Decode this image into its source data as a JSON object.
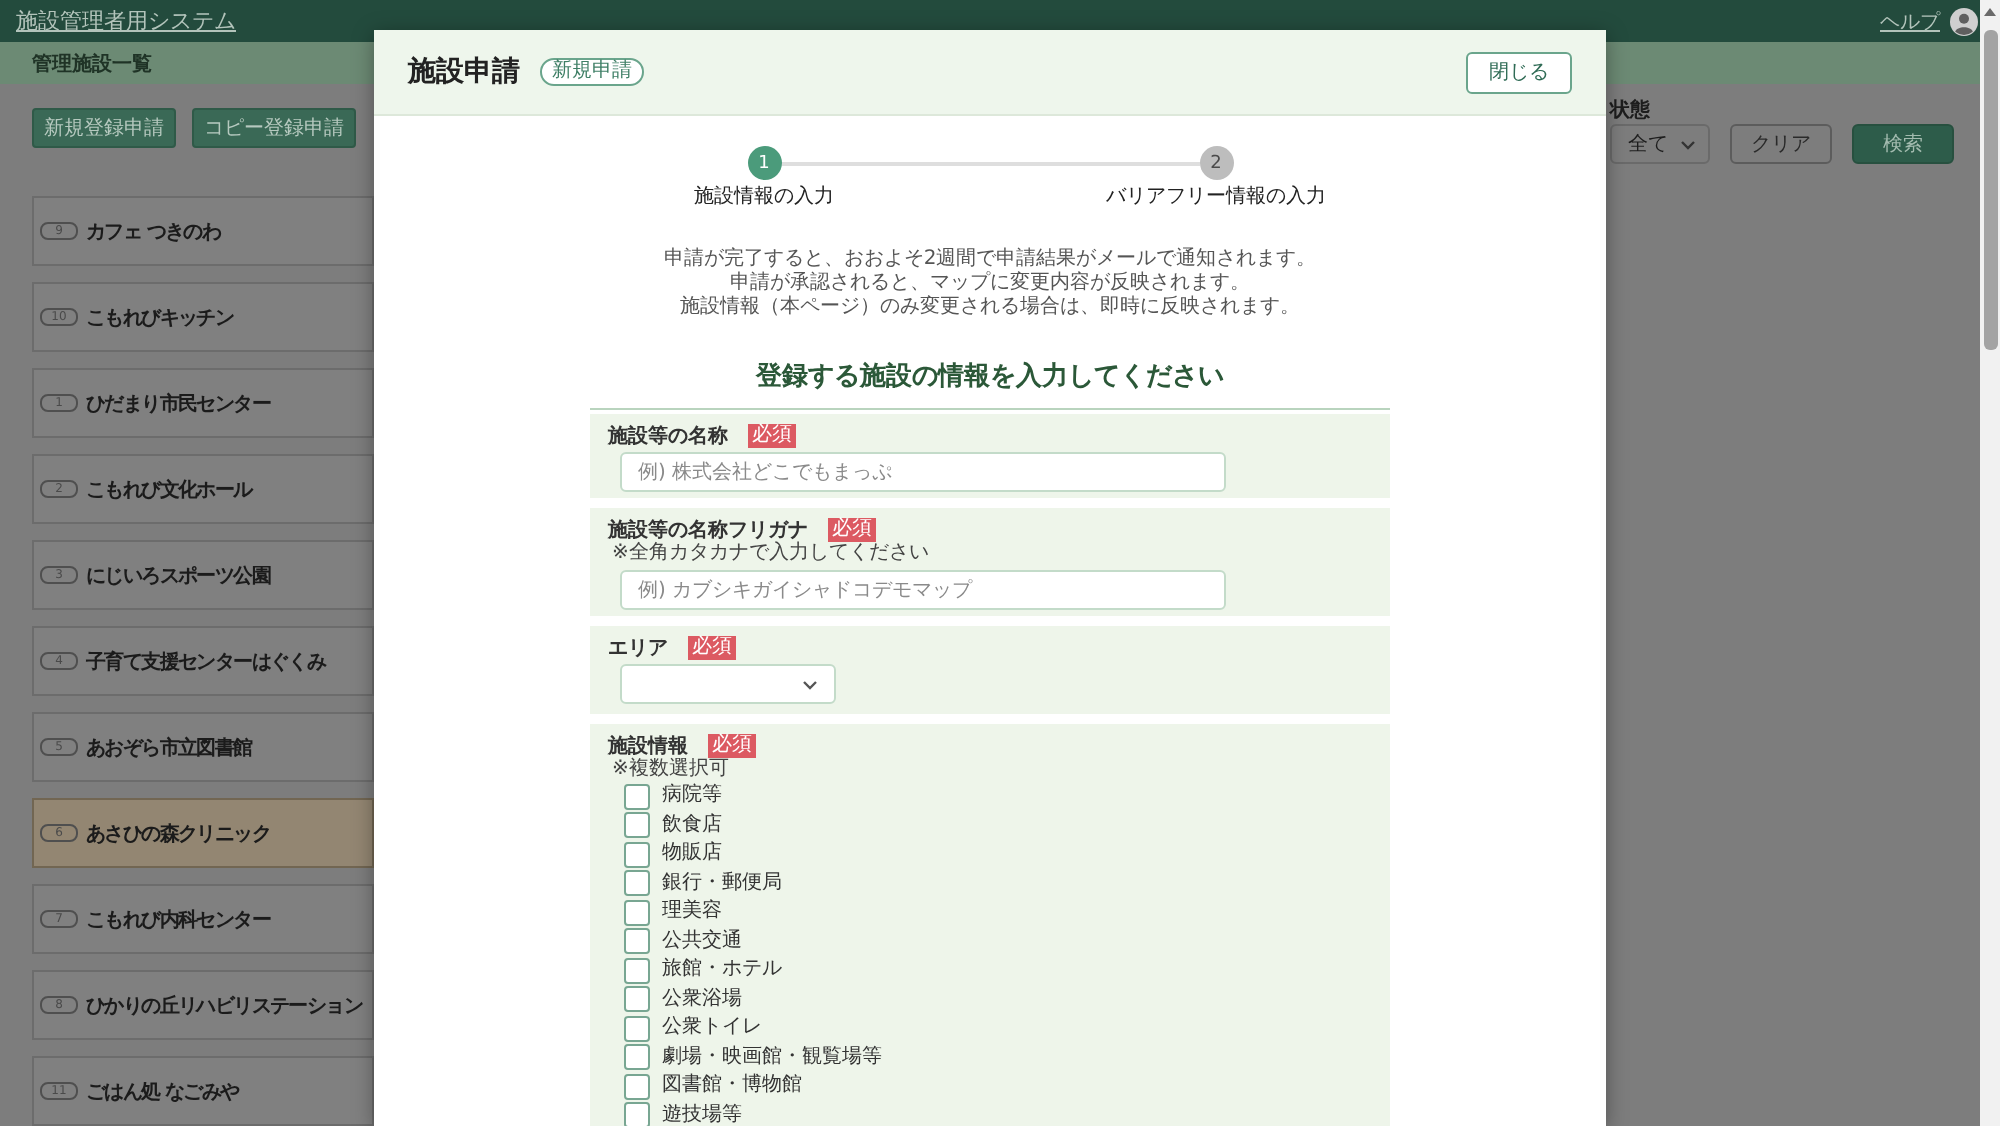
{
  "app_header": {
    "title": "施設管理者用システム",
    "help_link": "ヘルプ"
  },
  "page_header": {
    "title": "管理施設一覧"
  },
  "actions": [
    {
      "label": "新規登録申請"
    },
    {
      "label": "コピー登録申請"
    }
  ],
  "filters": {
    "status_label": "状態",
    "status_value": "全て",
    "buttons": [
      {
        "label": "クリア",
        "kind": "outline"
      },
      {
        "label": "検索",
        "kind": "primary"
      }
    ]
  },
  "facilities": [
    {
      "number": "9",
      "name": "カフェ つきのわ",
      "selected": false
    },
    {
      "number": "10",
      "name": "こもれびキッチン",
      "selected": false
    },
    {
      "number": "1",
      "name": "ひだまり市民センター",
      "selected": false
    },
    {
      "number": "2",
      "name": "こもれび文化ホール",
      "selected": false
    },
    {
      "number": "3",
      "name": "にじいろスポーツ公園",
      "selected": false
    },
    {
      "number": "4",
      "name": "子育て支援センターはぐくみ",
      "selected": false
    },
    {
      "number": "5",
      "name": "あおぞら市立図書館",
      "selected": false
    },
    {
      "number": "6",
      "name": "あさひの森クリニック",
      "selected": true
    },
    {
      "number": "7",
      "name": "こもれび内科センター",
      "selected": false
    },
    {
      "number": "8",
      "name": "ひかりの丘リハビリステーション",
      "selected": false
    },
    {
      "number": "11",
      "name": "ごはん処 なごみや",
      "selected": false
    }
  ],
  "modal": {
    "title": "施設申請",
    "badge": "新規申請",
    "close_button": "閉じる",
    "steps": [
      {
        "number": "1",
        "label": "施設情報の入力",
        "current": true
      },
      {
        "number": "2",
        "label": "バリアフリー情報の入力",
        "current": false
      }
    ],
    "notice": [
      "申請が完了すると、おおよそ2週間で申請結果がメールで通知されます。",
      "申請が承認されると、マップに変更内容が反映されます。",
      "施設情報（本ページ）のみ変更される場合は、即時に反映されます。"
    ],
    "form_title": "登録する施設の情報を入力してください",
    "fields": [
      {
        "kind": "text",
        "label": "施設等の名称",
        "required_badge": "必須",
        "placeholder": "例) 株式会社どこでもまっぷ"
      },
      {
        "kind": "text",
        "label": "施設等の名称フリガナ",
        "required_badge": "必須",
        "note": "※全角カタカナで入力してください",
        "placeholder": "例) カブシキガイシャドコデモマップ"
      },
      {
        "kind": "select",
        "label": "エリア",
        "required_badge": "必須"
      },
      {
        "kind": "checkboxes",
        "label": "施設情報",
        "required_badge": "必須",
        "note": "※複数選択可",
        "options": [
          {
            "label": "病院等",
            "checked": false
          },
          {
            "label": "飲食店",
            "checked": false
          },
          {
            "label": "物販店",
            "checked": false
          },
          {
            "label": "銀行・郵便局",
            "checked": false
          },
          {
            "label": "理美容",
            "checked": false
          },
          {
            "label": "公共交通",
            "checked": false
          },
          {
            "label": "旅館・ホテル",
            "checked": false
          },
          {
            "label": "公衆浴場",
            "checked": false
          },
          {
            "label": "公衆トイレ",
            "checked": false
          },
          {
            "label": "劇場・映画館・観覧場等",
            "checked": false
          },
          {
            "label": "図書館・博物館",
            "checked": false
          },
          {
            "label": "遊技場等",
            "checked": false
          }
        ]
      }
    ]
  }
}
